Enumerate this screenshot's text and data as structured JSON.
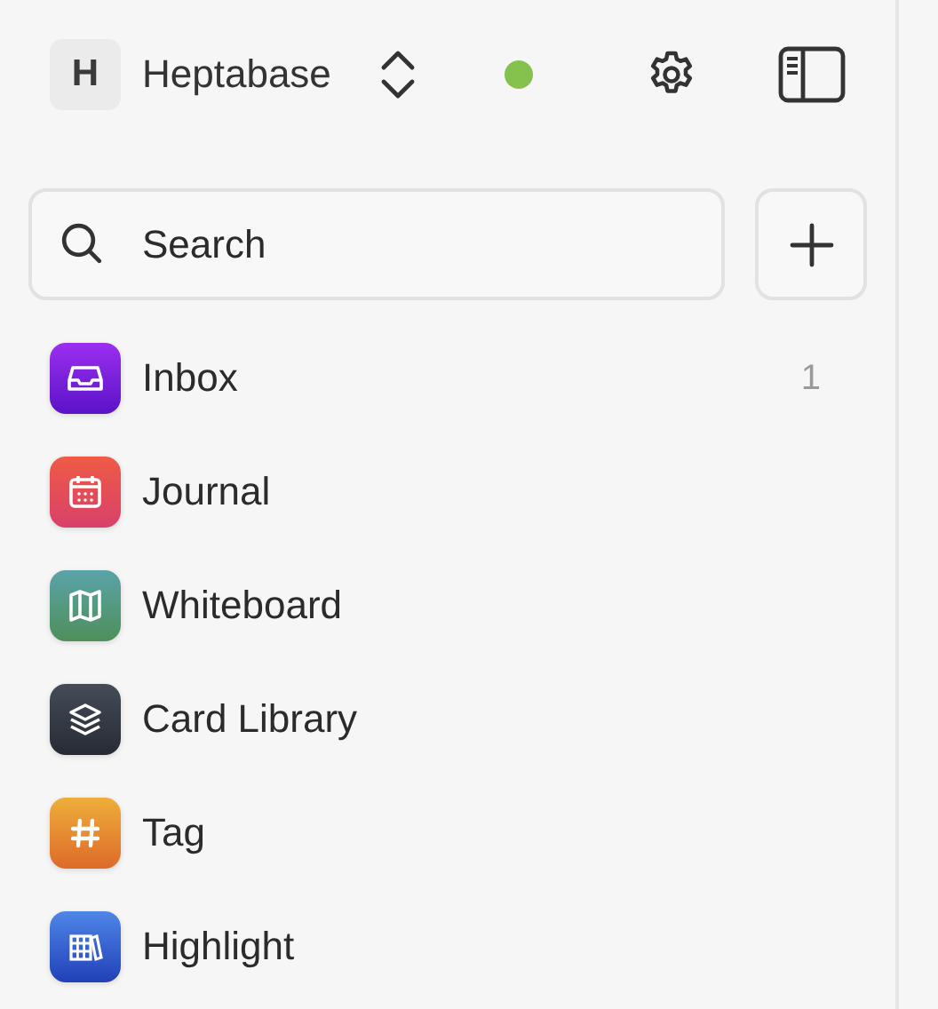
{
  "workspace": {
    "initial": "H",
    "name": "Heptabase"
  },
  "search": {
    "placeholder": "Search"
  },
  "nav_items": [
    {
      "kind": "inbox",
      "label": "Inbox",
      "count": "1"
    },
    {
      "kind": "journal",
      "label": "Journal"
    },
    {
      "kind": "whiteboard",
      "label": "Whiteboard"
    },
    {
      "kind": "library",
      "label": "Card Library"
    },
    {
      "kind": "tag",
      "label": "Tag"
    },
    {
      "kind": "highlight",
      "label": "Highlight"
    }
  ]
}
